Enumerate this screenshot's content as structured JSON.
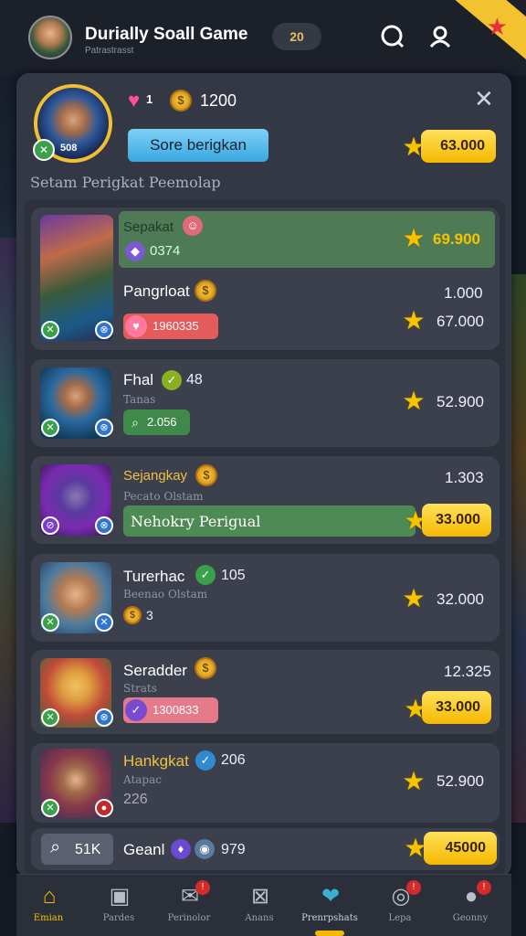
{
  "header": {
    "title": "Durially Soall Game",
    "subtitle": "Patrastrasst",
    "counter": "20"
  },
  "profile": {
    "level_number": "508",
    "hearts_count": "1",
    "coins": "1200",
    "store_button": "Sore berigkan",
    "gold_total": "63.000",
    "section_label": "Setam Perigkat Peemolap"
  },
  "rows": [
    {
      "name": "Sepakat",
      "sub_value": "0374",
      "highlight_value": "69.900",
      "second_name": "Pangrloat",
      "second_value": "1.000",
      "chip": "1960335",
      "stars_value": "67.000"
    },
    {
      "name": "Fhal",
      "num": "48",
      "subtitle": "Tanas",
      "chip": "2.056",
      "stars_value": "52.900"
    },
    {
      "name": "Sejangkay",
      "subtitle": "Pecato Olstam",
      "top_value": "1.303",
      "bar_text": "Nehokry Perigual",
      "gold_value": "33.000"
    },
    {
      "name": "Turerhac",
      "num": "105",
      "subtitle": "Beenao Olstam",
      "coin_count": "3",
      "stars_value": "32.000"
    },
    {
      "name": "Seradder",
      "subtitle": "Strats",
      "top_value": "12.325",
      "chip": "1300833",
      "gold_value": "33.000"
    },
    {
      "name": "Hankgkat",
      "num": "206",
      "subtitle": "Atapac",
      "sub_value": "226",
      "stars_value": "52.900"
    }
  ],
  "footer_row": {
    "search_value": "51K",
    "name": "Geanl",
    "num": "979",
    "gold_value": "45000"
  },
  "nav": {
    "items": [
      {
        "label": "Emian",
        "icon": "home-icon",
        "badge": ""
      },
      {
        "label": "Pardes",
        "icon": "store-icon",
        "badge": ""
      },
      {
        "label": "Perinolor",
        "icon": "mail-icon",
        "badge": "!"
      },
      {
        "label": "Anans",
        "icon": "envelope-icon",
        "badge": ""
      },
      {
        "label": "Prenrpshats",
        "icon": "leaderboard-icon",
        "badge": ""
      },
      {
        "label": "Lepa",
        "icon": "target-icon",
        "badge": "!"
      },
      {
        "label": "Geonny",
        "icon": "chat-icon",
        "badge": "!"
      }
    ]
  },
  "colors": {
    "accent_gold": "#f5b800",
    "accent_blue": "#3aa8e0",
    "panel": "#333844"
  }
}
